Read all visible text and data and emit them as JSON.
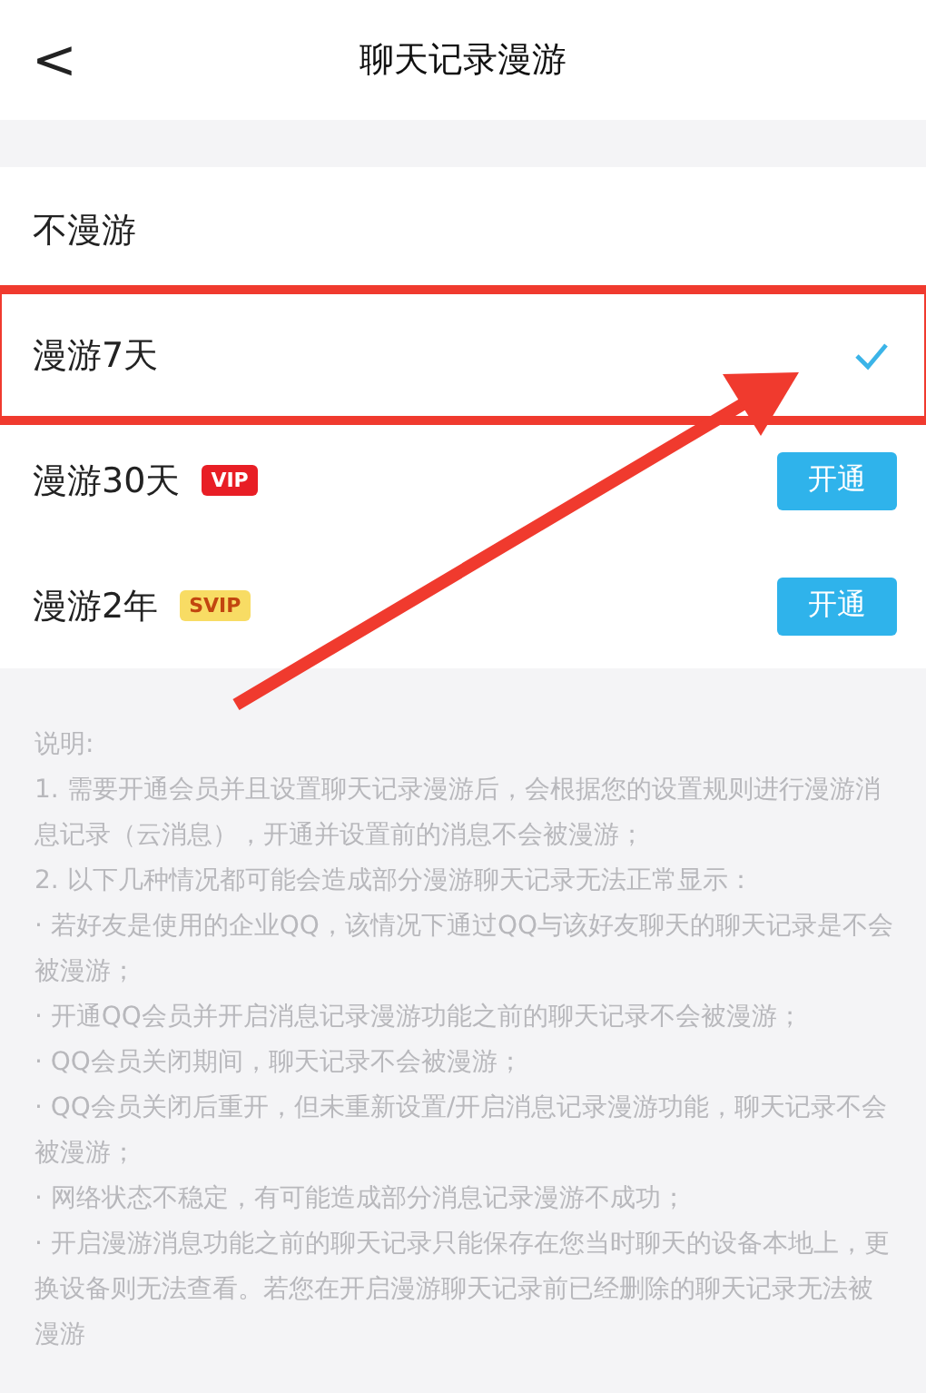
{
  "header": {
    "back": "<",
    "title": "聊天记录漫游"
  },
  "options": [
    {
      "label": "不漫游",
      "selected": false
    },
    {
      "label": "漫游7天",
      "selected": true,
      "highlighted": true
    },
    {
      "label": "漫游30天",
      "selected": false,
      "badge": {
        "text": "VIP",
        "color": "#e81e25"
      },
      "action": "开通"
    },
    {
      "label": "漫游2年",
      "selected": false,
      "badge": {
        "text": "SVIP",
        "color": "#f8dc64"
      },
      "action": "开通"
    }
  ],
  "notes": [
    "说明:",
    "1. 需要开通会员并且设置聊天记录漫游后，会根据您的设置规则进行漫游消息记录（云消息），开通并设置前的消息不会被漫游；",
    "2. 以下几种情况都可能会造成部分漫游聊天记录无法正常显示：",
    "· 若好友是使用的企业QQ，该情况下通过QQ与该好友聊天的聊天记录是不会被漫游；",
    "· 开通QQ会员并开启消息记录漫游功能之前的聊天记录不会被漫游；",
    "· QQ会员关闭期间，聊天记录不会被漫游；",
    "· QQ会员关闭后重开，但未重新设置/开启消息记录漫游功能，聊天记录不会被漫游；",
    "· 网络状态不稳定，有可能造成部分消息记录漫游不成功；",
    "· 开启漫游消息功能之前的聊天记录只能保存在您当时聊天的设备本地上，更换设备则无法查看。若您在开启漫游聊天记录前已经删除的聊天记录无法被漫游"
  ]
}
